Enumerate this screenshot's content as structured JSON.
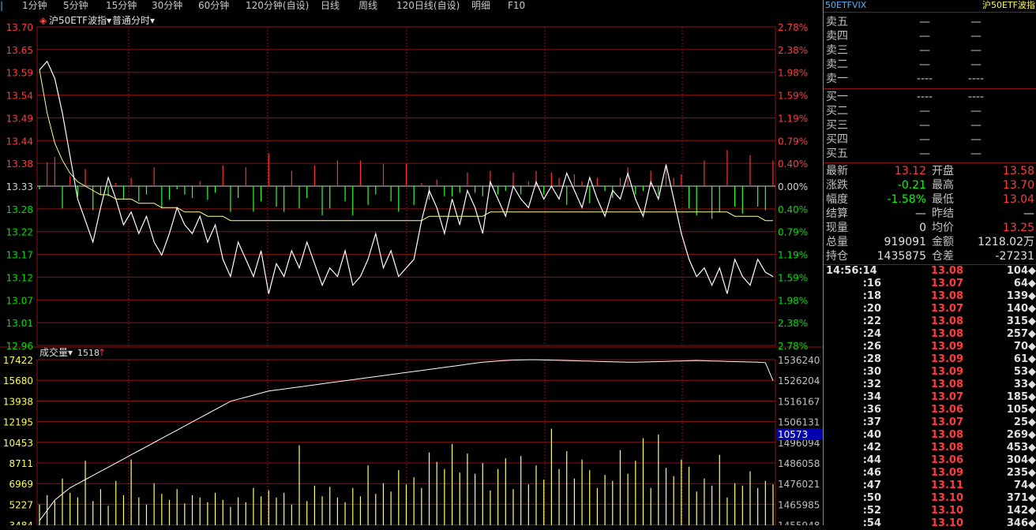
{
  "toolbar": {
    "items": [
      "1分钟",
      "5分钟",
      "15分钟",
      "30分钟",
      "60分钟",
      "120分钟(自设)",
      "日线",
      "周线",
      "120日线(自设)",
      "明细",
      "F10"
    ]
  },
  "price_panel": {
    "symbol_label": "沪50ETF波指",
    "mode_label": "普通分时",
    "left_ticks": [
      "13.70",
      "13.65",
      "13.59",
      "13.54",
      "13.49",
      "13.44",
      "13.38",
      "13.33",
      "13.28",
      "13.22",
      "13.17",
      "13.12",
      "13.07",
      "13.01",
      "12.96"
    ],
    "right_ticks": [
      "2.78%",
      "2.38%",
      "1.98%",
      "1.59%",
      "1.19%",
      "0.79%",
      "0.40%",
      "0.00%",
      "0.40%",
      "0.79%",
      "1.19%",
      "1.59%",
      "1.98%",
      "2.38%",
      "2.78%"
    ]
  },
  "volume_panel": {
    "label": "成交量",
    "value": "1518",
    "left_ticks": [
      "17422",
      "15680",
      "13938",
      "12195",
      "10453",
      "8711",
      "6969",
      "5227",
      "3484"
    ],
    "right_ticks": [
      "1536240",
      "1526204",
      "1516167",
      "1506131",
      "1496094",
      "1486058",
      "1476021",
      "1465985",
      "1455948"
    ],
    "cursor_value": "10573"
  },
  "chart_data": {
    "type": "line",
    "ylim": [
      12.96,
      13.7
    ],
    "prev_close": 13.33,
    "series": [
      {
        "name": "沪50ETF波指",
        "color": "#ffffff",
        "values": [
          13.6,
          13.62,
          13.58,
          13.5,
          13.4,
          13.3,
          13.25,
          13.2,
          13.28,
          13.35,
          13.3,
          13.24,
          13.27,
          13.22,
          13.26,
          13.2,
          13.17,
          13.22,
          13.28,
          13.24,
          13.22,
          13.26,
          13.2,
          13.24,
          13.16,
          13.12,
          13.2,
          13.16,
          13.12,
          13.18,
          13.08,
          13.15,
          13.12,
          13.18,
          13.14,
          13.2,
          13.15,
          13.1,
          13.14,
          13.12,
          13.18,
          13.1,
          13.12,
          13.16,
          13.22,
          13.14,
          13.18,
          13.12,
          13.14,
          13.16,
          13.25,
          13.32,
          13.28,
          13.22,
          13.3,
          13.24,
          13.32,
          13.28,
          13.22,
          13.34,
          13.3,
          13.26,
          13.33,
          13.3,
          13.28,
          13.34,
          13.3,
          13.33,
          13.3,
          13.36,
          13.32,
          13.28,
          13.35,
          13.3,
          13.26,
          13.32,
          13.3,
          13.36,
          13.3,
          13.26,
          13.34,
          13.3,
          13.38,
          13.3,
          13.22,
          13.16,
          13.12,
          13.14,
          13.1,
          13.14,
          13.08,
          13.16,
          13.12,
          13.1,
          13.16,
          13.13,
          13.12
        ]
      },
      {
        "name": "均价",
        "color": "#ffff99",
        "values": [
          13.6,
          13.5,
          13.43,
          13.39,
          13.36,
          13.34,
          13.33,
          13.32,
          13.31,
          13.31,
          13.3,
          13.3,
          13.3,
          13.29,
          13.29,
          13.29,
          13.28,
          13.28,
          13.28,
          13.27,
          13.27,
          13.27,
          13.26,
          13.26,
          13.26,
          13.25,
          13.25,
          13.25,
          13.25,
          13.25,
          13.25,
          13.25,
          13.25,
          13.25,
          13.25,
          13.25,
          13.25,
          13.25,
          13.25,
          13.25,
          13.25,
          13.25,
          13.25,
          13.25,
          13.25,
          13.25,
          13.25,
          13.25,
          13.25,
          13.25,
          13.25,
          13.26,
          13.26,
          13.26,
          13.26,
          13.26,
          13.26,
          13.26,
          13.26,
          13.27,
          13.27,
          13.27,
          13.27,
          13.27,
          13.27,
          13.27,
          13.27,
          13.27,
          13.27,
          13.27,
          13.27,
          13.27,
          13.27,
          13.27,
          13.27,
          13.27,
          13.27,
          13.27,
          13.27,
          13.27,
          13.27,
          13.27,
          13.27,
          13.27,
          13.27,
          13.27,
          13.27,
          13.27,
          13.27,
          13.27,
          13.27,
          13.26,
          13.26,
          13.26,
          13.26,
          13.25,
          13.25
        ]
      }
    ],
    "volume": {
      "ylim": [
        3484,
        17422
      ],
      "bars": [
        5200,
        6000,
        5500,
        7400,
        6200,
        5800,
        8900,
        5500,
        6500,
        5100,
        7200,
        6000,
        9000,
        5800,
        5200,
        7000,
        6100,
        5600,
        6500,
        5300,
        6000,
        5800,
        5400,
        6200,
        5600,
        5000,
        5800,
        5400,
        6600,
        5900,
        6400,
        5800,
        6200,
        5200,
        10200,
        5500,
        6800,
        5900,
        6700,
        5800,
        5400,
        6600,
        5900,
        8500,
        6100,
        7000,
        6300,
        8100,
        6900,
        7500,
        6600,
        9600,
        8800,
        8200,
        10300,
        7900,
        9500,
        7800,
        8700,
        6400,
        8200,
        9100,
        6500,
        9300,
        6900,
        8500,
        7300,
        11600,
        8200,
        9700,
        7400,
        9000,
        8100,
        6600,
        7700,
        7200,
        9800,
        7800,
        8900,
        10800,
        6600,
        11100,
        8300,
        7600,
        9000,
        8400,
        6300,
        7400,
        6800,
        9400,
        5800,
        7000,
        6800,
        8000,
        6600,
        7200,
        6900
      ],
      "cum_ylim": [
        1455948,
        1536240
      ],
      "cumulative": [
        1458000,
        1463000,
        1468000,
        1471000,
        1474000,
        1476000,
        1478000,
        1480000,
        1482000,
        1484000,
        1486000,
        1488000,
        1490000,
        1492000,
        1494000,
        1496000,
        1498000,
        1500000,
        1502000,
        1504000,
        1506000,
        1508000,
        1510000,
        1512000,
        1514000,
        1516000,
        1517000,
        1518000,
        1519000,
        1520000,
        1521000,
        1521500,
        1522000,
        1522500,
        1523000,
        1523500,
        1524000,
        1524500,
        1525000,
        1525500,
        1526000,
        1526500,
        1527000,
        1527500,
        1528000,
        1528500,
        1529000,
        1529500,
        1530000,
        1530500,
        1531000,
        1531500,
        1532000,
        1532500,
        1533000,
        1533500,
        1534000,
        1534500,
        1535000,
        1535300,
        1535600,
        1535800,
        1536000,
        1536100,
        1536200,
        1536200,
        1536100,
        1536000,
        1535900,
        1535800,
        1535700,
        1535600,
        1535500,
        1535400,
        1535300,
        1535200,
        1535100,
        1535000,
        1535000,
        1535100,
        1535200,
        1535300,
        1535400,
        1535500,
        1535600,
        1535700,
        1535800,
        1535700,
        1535600,
        1535500,
        1535400,
        1535300,
        1535200,
        1535100,
        1535000,
        1534800,
        1526000
      ]
    }
  },
  "quote": {
    "left_title": "50ETFVIX",
    "right_title": "沪50ETF波指",
    "ask_labels": [
      "卖五",
      "卖四",
      "卖三",
      "卖二",
      "卖一"
    ],
    "bid_labels": [
      "买一",
      "买二",
      "买三",
      "买四",
      "买五"
    ],
    "ob_dash": "—",
    "ob_dash_level1": "----",
    "stats": [
      {
        "l1": "最新",
        "v1": "13.12",
        "c1": "red",
        "l2": "开盘",
        "v2": "13.58",
        "c2": "red"
      },
      {
        "l1": "涨跌",
        "v1": "-0.21",
        "c1": "green",
        "l2": "最高",
        "v2": "13.70",
        "c2": "red"
      },
      {
        "l1": "幅度",
        "v1": "-1.58%",
        "c1": "green",
        "l2": "最低",
        "v2": "13.04",
        "c2": "red"
      },
      {
        "l1": "结算",
        "v1": "—",
        "c1": "white",
        "l2": "昨结",
        "v2": "—",
        "c2": "white"
      },
      {
        "l1": "现量",
        "v1": "0",
        "c1": "white",
        "l2": "均价",
        "v2": "13.25",
        "c2": "red"
      },
      {
        "l1": "总量",
        "v1": "919091",
        "c1": "white",
        "l2": "金额",
        "v2": "1218.02万",
        "c2": "white"
      },
      {
        "l1": "持仓",
        "v1": "1435875",
        "c1": "white",
        "l2": "仓差",
        "v2": "-27231",
        "c2": "white"
      }
    ],
    "ticks": [
      {
        "t": "14:56:14",
        "p": "13.08",
        "v": "104◆"
      },
      {
        "t": ":16",
        "p": "13.07",
        "v": "64◆"
      },
      {
        "t": ":18",
        "p": "13.08",
        "v": "139◆"
      },
      {
        "t": ":20",
        "p": "13.07",
        "v": "140◆"
      },
      {
        "t": ":22",
        "p": "13.08",
        "v": "315◆"
      },
      {
        "t": ":24",
        "p": "13.08",
        "v": "257◆"
      },
      {
        "t": ":26",
        "p": "13.09",
        "v": "70◆"
      },
      {
        "t": ":28",
        "p": "13.09",
        "v": "61◆"
      },
      {
        "t": ":30",
        "p": "13.09",
        "v": "53◆"
      },
      {
        "t": ":32",
        "p": "13.08",
        "v": "33◆"
      },
      {
        "t": ":34",
        "p": "13.07",
        "v": "185◆"
      },
      {
        "t": ":36",
        "p": "13.06",
        "v": "105◆"
      },
      {
        "t": ":37",
        "p": "13.07",
        "v": "25◆"
      },
      {
        "t": ":40",
        "p": "13.08",
        "v": "269◆"
      },
      {
        "t": ":42",
        "p": "13.08",
        "v": "453◆"
      },
      {
        "t": ":44",
        "p": "13.06",
        "v": "304◆"
      },
      {
        "t": ":46",
        "p": "13.09",
        "v": "235◆"
      },
      {
        "t": ":47",
        "p": "13.11",
        "v": "74◆"
      },
      {
        "t": ":50",
        "p": "13.10",
        "v": "371◆"
      },
      {
        "t": ":52",
        "p": "13.10",
        "v": "142◆"
      },
      {
        "t": ":54",
        "p": "13.10",
        "v": "346◆"
      }
    ]
  }
}
